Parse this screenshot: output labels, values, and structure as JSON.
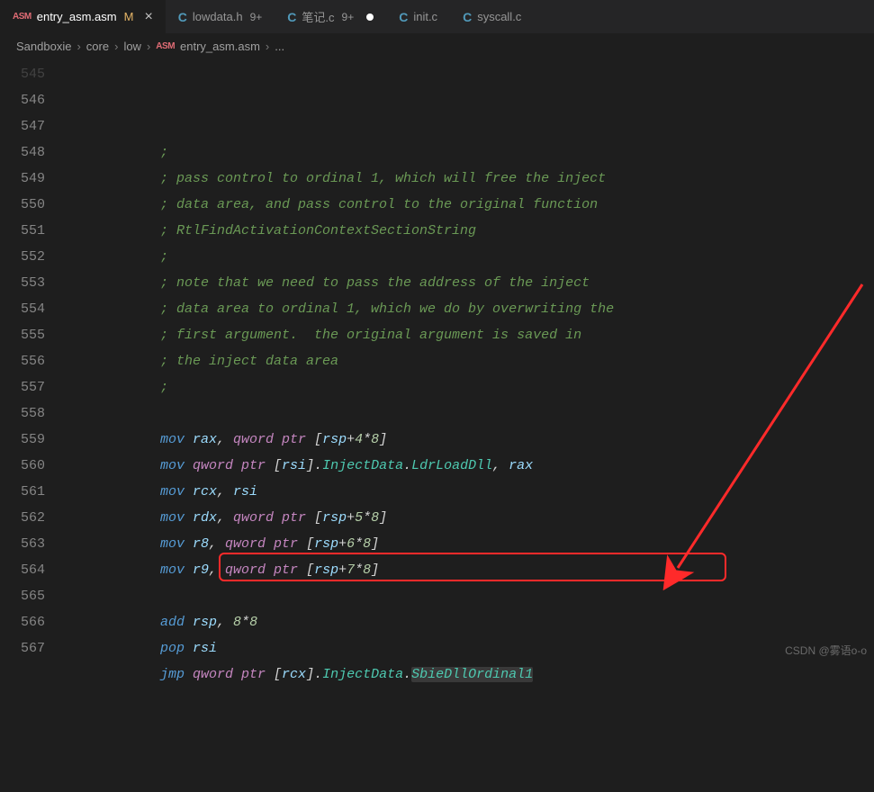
{
  "tabs": [
    {
      "icon": "ASM",
      "name": "entry_asm.asm",
      "modified": "M",
      "active": true,
      "close": "×"
    },
    {
      "icon": "C",
      "name": "lowdata.h",
      "badge": "9+"
    },
    {
      "icon": "C",
      "name": "笔记.c",
      "badge": "9+",
      "dirty": true
    },
    {
      "icon": "C",
      "name": "init.c"
    },
    {
      "icon": "C",
      "name": "syscall.c"
    }
  ],
  "breadcrumbs": {
    "parts": [
      "Sandboxie",
      "core",
      "low",
      "entry_asm.asm",
      "..."
    ],
    "sep": "›",
    "icon_at": 3
  },
  "gutter": [
    "545",
    "546",
    "547",
    "548",
    "549",
    "550",
    "551",
    "552",
    "553",
    "554",
    "555",
    "556",
    "557",
    "558",
    "559",
    "560",
    "561",
    "562",
    "563",
    "564",
    "565",
    "566",
    "567"
  ],
  "lines": [
    {
      "t": "c",
      "s": ";"
    },
    {
      "t": "c",
      "s": "; pass control to ordinal 1, which will free the inject"
    },
    {
      "t": "c",
      "s": "; data area, and pass control to the original function"
    },
    {
      "t": "c",
      "s": "; RtlFindActivationContextSectionString"
    },
    {
      "t": "c",
      "s": ";"
    },
    {
      "t": "c",
      "s": "; note that we need to pass the address of the inject"
    },
    {
      "t": "c",
      "s": "; data area to ordinal 1, which we do by overwriting the"
    },
    {
      "t": "c",
      "s": "; first argument.  the original argument is saved in"
    },
    {
      "t": "c",
      "s": "; the inject data area"
    },
    {
      "t": "c",
      "s": ";"
    },
    {
      "t": "e"
    },
    {
      "t": "i",
      "p": [
        [
          "mov ",
          "m"
        ],
        [
          "rax",
          "r"
        ],
        [
          ", ",
          "p"
        ],
        [
          "qword ptr",
          "k"
        ],
        [
          " [",
          "p"
        ],
        [
          "rsp",
          "r"
        ],
        [
          "+",
          "p"
        ],
        [
          "4",
          "n"
        ],
        [
          "*",
          "p"
        ],
        [
          "8",
          "n"
        ],
        [
          "]",
          "p"
        ]
      ]
    },
    {
      "t": "i",
      "p": [
        [
          "mov ",
          "m"
        ],
        [
          "qword ptr",
          "k"
        ],
        [
          " [",
          "p"
        ],
        [
          "rsi",
          "r"
        ],
        [
          "].",
          "p"
        ],
        [
          "InjectData",
          "mb"
        ],
        [
          ".",
          "p"
        ],
        [
          "LdrLoadDll",
          "mb"
        ],
        [
          ", ",
          "p"
        ],
        [
          "rax",
          "r"
        ]
      ]
    },
    {
      "t": "i",
      "p": [
        [
          "mov ",
          "m"
        ],
        [
          "rcx",
          "r"
        ],
        [
          ", ",
          "p"
        ],
        [
          "rsi",
          "r"
        ]
      ]
    },
    {
      "t": "i",
      "p": [
        [
          "mov ",
          "m"
        ],
        [
          "rdx",
          "r"
        ],
        [
          ", ",
          "p"
        ],
        [
          "qword ptr",
          "k"
        ],
        [
          " [",
          "p"
        ],
        [
          "rsp",
          "r"
        ],
        [
          "+",
          "p"
        ],
        [
          "5",
          "n"
        ],
        [
          "*",
          "p"
        ],
        [
          "8",
          "n"
        ],
        [
          "]",
          "p"
        ]
      ]
    },
    {
      "t": "i",
      "p": [
        [
          "mov ",
          "m"
        ],
        [
          "r8",
          "r"
        ],
        [
          ", ",
          "p"
        ],
        [
          "qword ptr",
          "k"
        ],
        [
          " [",
          "p"
        ],
        [
          "rsp",
          "r"
        ],
        [
          "+",
          "p"
        ],
        [
          "6",
          "n"
        ],
        [
          "*",
          "p"
        ],
        [
          "8",
          "n"
        ],
        [
          "]",
          "p"
        ]
      ]
    },
    {
      "t": "i",
      "p": [
        [
          "mov ",
          "m"
        ],
        [
          "r9",
          "r"
        ],
        [
          ", ",
          "p"
        ],
        [
          "qword ptr",
          "k"
        ],
        [
          " [",
          "p"
        ],
        [
          "rsp",
          "r"
        ],
        [
          "+",
          "p"
        ],
        [
          "7",
          "n"
        ],
        [
          "*",
          "p"
        ],
        [
          "8",
          "n"
        ],
        [
          "]",
          "p"
        ]
      ]
    },
    {
      "t": "e"
    },
    {
      "t": "i",
      "p": [
        [
          "add ",
          "m"
        ],
        [
          "rsp",
          "r"
        ],
        [
          ", ",
          "p"
        ],
        [
          "8",
          "n"
        ],
        [
          "*",
          "p"
        ],
        [
          "8",
          "n"
        ]
      ]
    },
    {
      "t": "i",
      "p": [
        [
          "pop ",
          "m"
        ],
        [
          "rsi",
          "r"
        ]
      ]
    },
    {
      "t": "i",
      "p": [
        [
          "jmp ",
          "m"
        ],
        [
          "qword ptr",
          "k"
        ],
        [
          " [",
          "p"
        ],
        [
          "rcx",
          "r"
        ],
        [
          "].",
          "p"
        ],
        [
          "InjectData",
          "mb"
        ],
        [
          ".",
          "p"
        ],
        [
          "SbieDllOrdinal1",
          "mb",
          true
        ]
      ]
    },
    {
      "t": "e"
    }
  ],
  "watermark": "CSDN @雾语o-o"
}
